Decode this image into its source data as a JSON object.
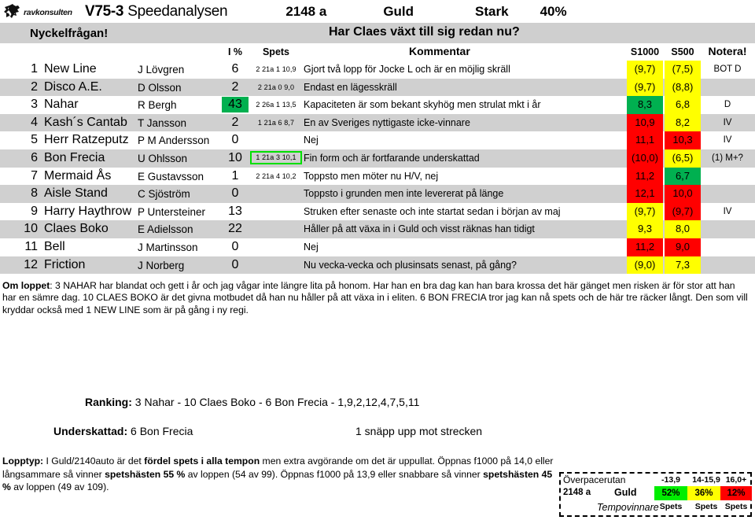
{
  "header": {
    "logo_text": "ravkonsulten",
    "race": "V75-3",
    "analysis_name": "Speedanalysen",
    "distance": "2148 a",
    "class": "Guld",
    "strength": "Stark",
    "percent": "40%"
  },
  "keybar": {
    "label": "Nyckelfrågan!",
    "question": "Har Claes växt till sig redan nu?"
  },
  "columns": {
    "ipct": "I %",
    "spets": "Spets",
    "kommentar": "Kommentar",
    "s1000": "S1000",
    "s500": "S500",
    "notera": "Notera!"
  },
  "rows": [
    {
      "num": "1",
      "horse": "New Line",
      "driver": "J Lövgren",
      "ipct": "6",
      "ipct_hl": false,
      "spets": "2 21a 1 10,9",
      "spets_boxed": false,
      "kommentar": "Gjort två lopp för Jocke L och är en möjlig skräll",
      "s1000": "(9,7)",
      "s1000_bg": "yellow",
      "s500": "(7,5)",
      "s500_bg": "yellow",
      "notera": "BOT D"
    },
    {
      "num": "2",
      "horse": "Disco A.E.",
      "driver": "D Olsson",
      "ipct": "2",
      "ipct_hl": false,
      "spets": "2 21a 0  9,0",
      "spets_boxed": false,
      "kommentar": "Endast en lägesskräll",
      "s1000": "(9,7)",
      "s1000_bg": "yellow",
      "s500": "(8,8)",
      "s500_bg": "yellow",
      "notera": ""
    },
    {
      "num": "3",
      "horse": "Nahar",
      "driver": "R Bergh",
      "ipct": "43",
      "ipct_hl": true,
      "spets": "2 26a 1 13,5",
      "spets_boxed": false,
      "kommentar": "Kapaciteten är som bekant skyhög men strulat mkt i år",
      "s1000": "8,3",
      "s1000_bg": "green",
      "s500": "6,8",
      "s500_bg": "yellow",
      "notera": "D"
    },
    {
      "num": "4",
      "horse": "Kash´s Cantab",
      "driver": "T Jansson",
      "ipct": "2",
      "ipct_hl": false,
      "spets": "1 21a 6  8,7",
      "spets_boxed": false,
      "kommentar": "En av Sveriges nyttigaste icke-vinnare",
      "s1000": "10,9",
      "s1000_bg": "red",
      "s500": "8,2",
      "s500_bg": "yellow",
      "notera": "IV"
    },
    {
      "num": "5",
      "horse": "Herr Ratzeputz",
      "driver": "P M Andersson",
      "ipct": "0",
      "ipct_hl": false,
      "spets": "",
      "spets_boxed": false,
      "kommentar": "Nej",
      "s1000": "11,1",
      "s1000_bg": "red",
      "s500": "10,3",
      "s500_bg": "red",
      "notera": "IV"
    },
    {
      "num": "6",
      "horse": "Bon Frecia",
      "driver": "U Ohlsson",
      "ipct": "10",
      "ipct_hl": false,
      "spets": "1 21a 3 10,1",
      "spets_boxed": true,
      "kommentar": "Fin form och är fortfarande underskattad",
      "s1000": "(10,0)",
      "s1000_bg": "red",
      "s500": "(6,5)",
      "s500_bg": "yellow",
      "notera": "(1) M+?"
    },
    {
      "num": "7",
      "horse": "Mermaid Ås",
      "driver": "E Gustavsson",
      "ipct": "1",
      "ipct_hl": false,
      "spets": "2 21a 4 10,2",
      "spets_boxed": false,
      "kommentar": "Toppsto men möter nu H/V, nej",
      "s1000": "11,2",
      "s1000_bg": "red",
      "s500": "6,7",
      "s500_bg": "green",
      "notera": ""
    },
    {
      "num": "8",
      "horse": "Aisle Stand",
      "driver": "C Sjöström",
      "ipct": "0",
      "ipct_hl": false,
      "spets": "",
      "spets_boxed": false,
      "kommentar": "Toppsto i grunden men inte levererat på länge",
      "s1000": "12,1",
      "s1000_bg": "red",
      "s500": "10,0",
      "s500_bg": "red",
      "notera": ""
    },
    {
      "num": "9",
      "horse": "Harry Haythrow",
      "driver": "P Untersteiner",
      "ipct": "13",
      "ipct_hl": false,
      "spets": "",
      "spets_boxed": false,
      "kommentar": "Struken efter senaste och inte startat sedan i början av maj",
      "s1000": "(9,7)",
      "s1000_bg": "yellow",
      "s500": "(9,7)",
      "s500_bg": "red",
      "notera": "IV"
    },
    {
      "num": "10",
      "horse": "Claes Boko",
      "driver": "E Adielsson",
      "ipct": "22",
      "ipct_hl": false,
      "spets": "",
      "spets_boxed": false,
      "kommentar": "Håller på att växa in i Guld och visst räknas han tidigt",
      "s1000": "9,3",
      "s1000_bg": "yellow",
      "s500": "8,0",
      "s500_bg": "yellow",
      "notera": ""
    },
    {
      "num": "11",
      "horse": "Bell",
      "driver": "J Martinsson",
      "ipct": "0",
      "ipct_hl": false,
      "spets": "",
      "spets_boxed": false,
      "kommentar": "Nej",
      "s1000": "11,2",
      "s1000_bg": "red",
      "s500": "9,0",
      "s500_bg": "red",
      "notera": ""
    },
    {
      "num": "12",
      "horse": "Friction",
      "driver": "J Norberg",
      "ipct": "0",
      "ipct_hl": false,
      "spets": "",
      "spets_boxed": false,
      "kommentar": "Nu vecka-vecka och plusinsats senast, på gång?",
      "s1000": "(9,0)",
      "s1000_bg": "yellow",
      "s500": "7,3",
      "s500_bg": "yellow",
      "notera": ""
    }
  ],
  "omloppet": {
    "label": "Om loppet",
    "text": ": 3 NAHAR har blandat och gett i år och jag vågar inte längre lita på honom. Har han en bra dag kan han bara krossa det här gänget men risken är för stor att han har en sämre dag. 10 CLAES BOKO är det givna motbudet då han nu håller på att växa in i eliten. 6 BON FRECIA tror jag kan nå spets och de här tre räcker långt. Den som vill kryddar också med 1 NEW LINE som är på gång i ny regi."
  },
  "ranking": {
    "label": "Ranking:",
    "value": "3 Nahar - 10 Claes Boko - 6 Bon Frecia - 1,9,2,12,4,7,5,11"
  },
  "underskattad": {
    "label": "Underskattad:",
    "value": "6 Bon Frecia",
    "note": "1 snäpp upp mot strecken"
  },
  "lopptyp": {
    "label": "Lopptyp:",
    "part1": " I Guld/2140auto är det ",
    "bold1": "fördel spets i alla tempon",
    "part2": " men extra avgörande om det är uppullat. Öppnas f1000 på 14,0 eller långsammare så vinner ",
    "bold2": "spetshästen 55 %",
    "part3": " av loppen (54 av 99). Öppnas f1000 på 13,9 eller snabbare så vinner ",
    "bold3": "spetshästen 45 %",
    "part4": " av loppen (49 av 109)."
  },
  "overpace_box": {
    "title": "Överpacerutan",
    "distance": "2148 a",
    "class": "Guld",
    "tempo_label": "Tempovinnare",
    "headers": [
      "-13,9",
      "14-15,9",
      "16,0+"
    ],
    "values": [
      "52%",
      "36%",
      "12%"
    ],
    "sublabels": [
      "Spets",
      "Spets",
      "Spets"
    ],
    "value_colors": [
      "#00ee00",
      "#ffff00",
      "#ff0000"
    ]
  },
  "colors": {
    "green": "#00b050",
    "yellow": "#ffff00",
    "red": "#ff0000",
    "row_alt": "#d0d0d0",
    "keybar": "#cfcfcf"
  }
}
